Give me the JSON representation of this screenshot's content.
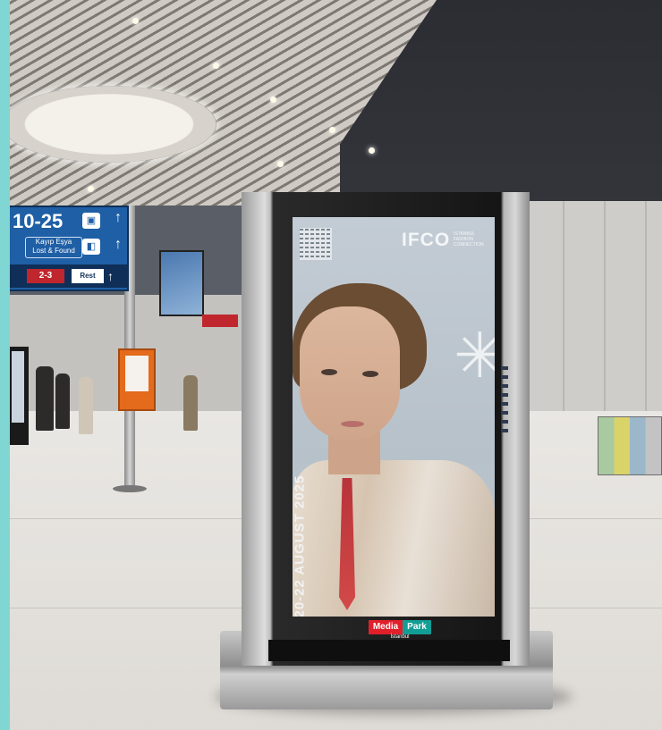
{
  "wayfinding_sign": {
    "gate_range": "10-25",
    "lost_found_tr": "Kayıp Eşya",
    "lost_found_en": "Lost & Found",
    "bottom_gate_label": "2-3",
    "bottom_label": "Rest"
  },
  "display_ad": {
    "brand": "IFCO",
    "brand_tagline": "ISTANBUL FASHION CONNECTION",
    "dates": "20-22 AUGUST 2025"
  },
  "kiosk_logo": {
    "part1": "Media",
    "part2": "Park",
    "city": "İstanbul"
  },
  "colors": {
    "sign_blue": "#1f5fa5",
    "logo_red": "#e11f2b",
    "logo_teal": "#119e95"
  }
}
